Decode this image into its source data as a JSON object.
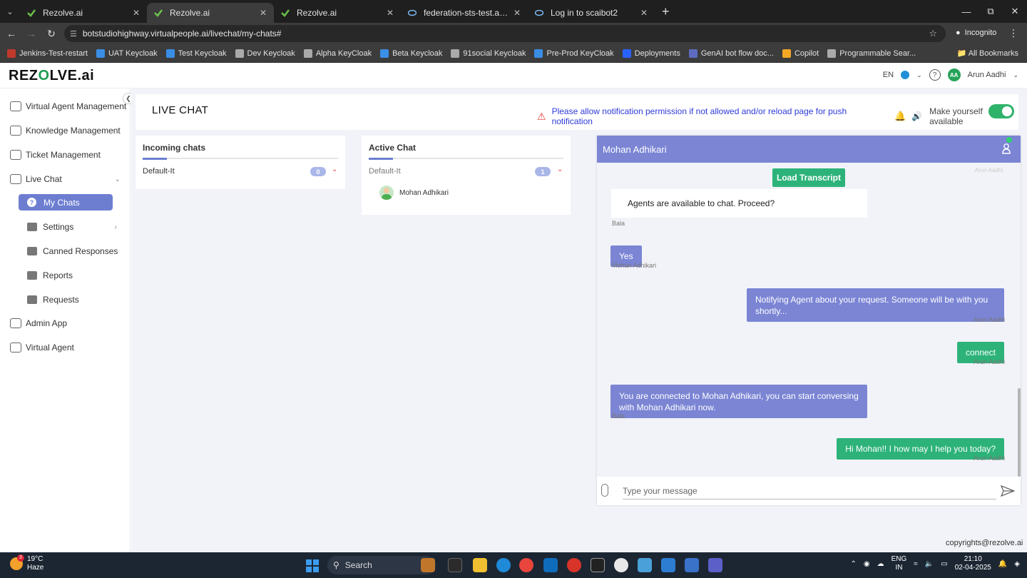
{
  "browser": {
    "tabs": [
      {
        "title": "Rezolve.ai",
        "active": false
      },
      {
        "title": "Rezolve.ai",
        "active": true
      },
      {
        "title": "Rezolve.ai",
        "active": false
      },
      {
        "title": "federation-sts-test.apps.actionab",
        "active": false
      },
      {
        "title": "Log in to scaibot2",
        "active": false
      }
    ],
    "url": "botstudiohighway.virtualpeople.ai/livechat/my-chats#",
    "incognito_label": "Incognito",
    "bookmarks": [
      {
        "label": "Jenkins-Test-restart",
        "color": "#c0392b"
      },
      {
        "label": "UAT Keycloak",
        "color": "#3a8ee6"
      },
      {
        "label": "Test Keycloak",
        "color": "#3a8ee6"
      },
      {
        "label": "Dev Keycloak",
        "color": "#aaaaaa"
      },
      {
        "label": "Alpha KeyCloak",
        "color": "#aaaaaa"
      },
      {
        "label": "Beta Keycloak",
        "color": "#3a8ee6"
      },
      {
        "label": "91social Keycloak",
        "color": "#aaaaaa"
      },
      {
        "label": "Pre-Prod KeyCloak",
        "color": "#3a8ee6"
      },
      {
        "label": "Deployments",
        "color": "#2962ff"
      },
      {
        "label": "GenAI bot flow doc...",
        "color": "#5c6bc0"
      },
      {
        "label": "Copilot",
        "color": "#f5a623"
      },
      {
        "label": "Programmable Sear...",
        "color": "#aaaaaa"
      }
    ],
    "all_bookmarks": "All Bookmarks"
  },
  "header": {
    "logo": "REZOLVE.ai",
    "language": "EN",
    "user_initials": "AA",
    "user_name": "Arun Aadhi"
  },
  "sidebar": {
    "items": [
      {
        "label": "Virtual Agent Management",
        "icon": "people-gear-icon"
      },
      {
        "label": "Knowledge Management",
        "icon": "book-icon"
      },
      {
        "label": "Ticket Management",
        "icon": "ticket-icon"
      },
      {
        "label": "Live Chat",
        "icon": "chat-icon"
      }
    ],
    "sub_items": [
      {
        "label": "My Chats",
        "icon": "question-icon",
        "active": true
      },
      {
        "label": "Settings",
        "icon": "settings-icon"
      },
      {
        "label": "Canned Responses",
        "icon": "book-stack-icon"
      },
      {
        "label": "Reports",
        "icon": "chart-line-icon"
      },
      {
        "label": "Requests",
        "icon": "user-request-icon"
      }
    ],
    "bottom_items": [
      {
        "label": "Admin App",
        "icon": "sliders-icon"
      },
      {
        "label": "Virtual Agent",
        "icon": "headset-icon"
      }
    ]
  },
  "live_chat": {
    "title": "LIVE CHAT",
    "notification": "Please allow notification permission if not allowed and/or reload page for push notification",
    "availability_label": "Make yourself available",
    "available": true
  },
  "incoming": {
    "heading": "Incoming chats",
    "queue": "Default-It",
    "count": "0"
  },
  "active": {
    "heading": "Active Chat",
    "queue": "Default-It",
    "count": "1",
    "chats": [
      {
        "name": "Mohan Adhikari"
      }
    ]
  },
  "chat": {
    "contact_name": "Mohan Adhikari",
    "load_transcript": "Load Transcript",
    "faded_sender": "Arun Aadhi",
    "messages": [
      {
        "side": "left",
        "style": "white",
        "text": "Agents are available to chat. Proceed?",
        "sender": "Bala"
      },
      {
        "side": "left",
        "style": "blue",
        "text": "Yes",
        "sender": "Mohan Adhikari"
      },
      {
        "side": "right",
        "style": "blue",
        "text": "Notifying Agent about your request. Someone will be with you shortly...",
        "sender": "Arun Aadhi"
      },
      {
        "side": "right",
        "style": "green",
        "text": "connect",
        "sender": "Arun Aadhi"
      },
      {
        "side": "left",
        "style": "blue",
        "text": "You are connected to Mohan Adhikari, you can start conversing with Mohan Adhikari now.",
        "sender": "Bala"
      },
      {
        "side": "right",
        "style": "green",
        "text": "Hi Mohan!! I how may I help you today?",
        "sender": "Arun Aadhi"
      }
    ],
    "input_placeholder": "Type your message"
  },
  "footer": "copyrights@rezolve.ai",
  "taskbar": {
    "temperature": "19°C",
    "weather": "Haze",
    "weather_badge": "3",
    "search_label": "Search",
    "language_top": "ENG",
    "language_bottom": "IN",
    "time": "21:10",
    "date": "02-04-2025"
  }
}
